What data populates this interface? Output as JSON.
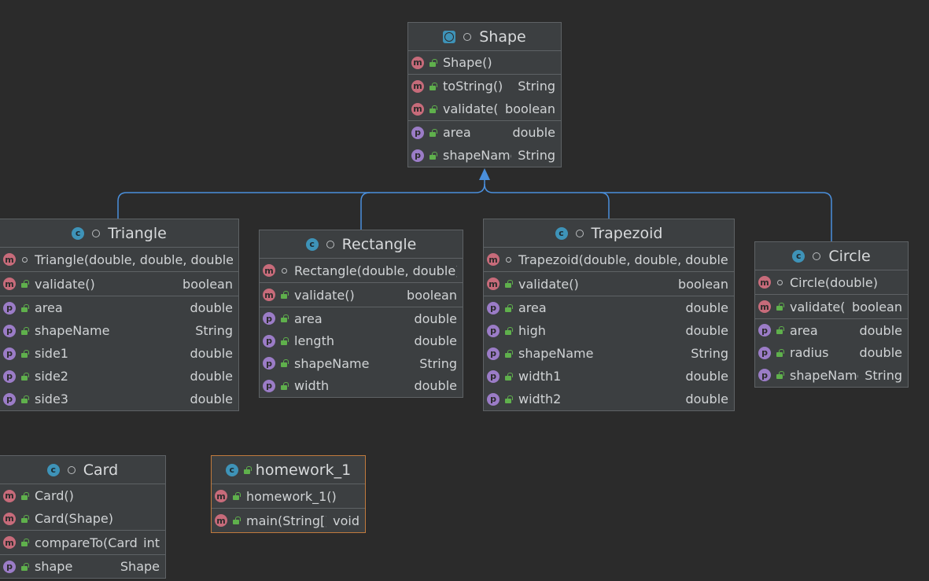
{
  "classes": {
    "shape": {
      "name": "Shape",
      "constructors": [
        {
          "name": "Shape()",
          "type": ""
        }
      ],
      "methods": [
        {
          "name": "toString()",
          "type": "String"
        },
        {
          "name": "validate()",
          "type": "boolean"
        }
      ],
      "fields": [
        {
          "name": "area",
          "type": "double"
        },
        {
          "name": "shapeName",
          "type": "String"
        }
      ]
    },
    "triangle": {
      "name": "Triangle",
      "constructors": [
        {
          "name": "Triangle(double, double, double)",
          "type": ""
        }
      ],
      "methods": [
        {
          "name": "validate()",
          "type": "boolean"
        }
      ],
      "fields": [
        {
          "name": "area",
          "type": "double"
        },
        {
          "name": "shapeName",
          "type": "String"
        },
        {
          "name": "side1",
          "type": "double"
        },
        {
          "name": "side2",
          "type": "double"
        },
        {
          "name": "side3",
          "type": "double"
        }
      ]
    },
    "rectangle": {
      "name": "Rectangle",
      "constructors": [
        {
          "name": "Rectangle(double, double)",
          "type": ""
        }
      ],
      "methods": [
        {
          "name": "validate()",
          "type": "boolean"
        }
      ],
      "fields": [
        {
          "name": "area",
          "type": "double"
        },
        {
          "name": "length",
          "type": "double"
        },
        {
          "name": "shapeName",
          "type": "String"
        },
        {
          "name": "width",
          "type": "double"
        }
      ]
    },
    "trapezoid": {
      "name": "Trapezoid",
      "constructors": [
        {
          "name": "Trapezoid(double, double, double)",
          "type": ""
        }
      ],
      "methods": [
        {
          "name": "validate()",
          "type": "boolean"
        }
      ],
      "fields": [
        {
          "name": "area",
          "type": "double"
        },
        {
          "name": "high",
          "type": "double"
        },
        {
          "name": "shapeName",
          "type": "String"
        },
        {
          "name": "width1",
          "type": "double"
        },
        {
          "name": "width2",
          "type": "double"
        }
      ]
    },
    "circle": {
      "name": "Circle",
      "constructors": [
        {
          "name": "Circle(double)",
          "type": ""
        }
      ],
      "methods": [
        {
          "name": "validate()",
          "type": "boolean"
        }
      ],
      "fields": [
        {
          "name": "area",
          "type": "double"
        },
        {
          "name": "radius",
          "type": "double"
        },
        {
          "name": "shapeName",
          "type": "String"
        }
      ]
    },
    "card": {
      "name": "Card",
      "constructors": [
        {
          "name": "Card()",
          "type": ""
        },
        {
          "name": "Card(Shape)",
          "type": ""
        }
      ],
      "methods": [
        {
          "name": "compareTo(Card)",
          "type": "int"
        }
      ],
      "fields": [
        {
          "name": "shape",
          "type": "Shape"
        }
      ]
    },
    "homework": {
      "name": "homework_1",
      "constructors": [
        {
          "name": "homework_1()",
          "type": ""
        }
      ],
      "methods": [
        {
          "name": "main(String[])",
          "type": "void"
        }
      ],
      "fields": []
    }
  },
  "colors": {
    "background": "#2b2b2b",
    "box": "#3c3f41",
    "border": "#5e6265",
    "selected_border": "#c07a3d",
    "inheritance_line": "#4a8fdc"
  },
  "icons": {
    "class": "class-icon",
    "abstract_class": "abstract-class-icon",
    "main_class": "runnable-class-icon",
    "method": "method-icon",
    "field": "property-icon",
    "public": "public-lock-icon",
    "package_private": "package-private-icon"
  }
}
